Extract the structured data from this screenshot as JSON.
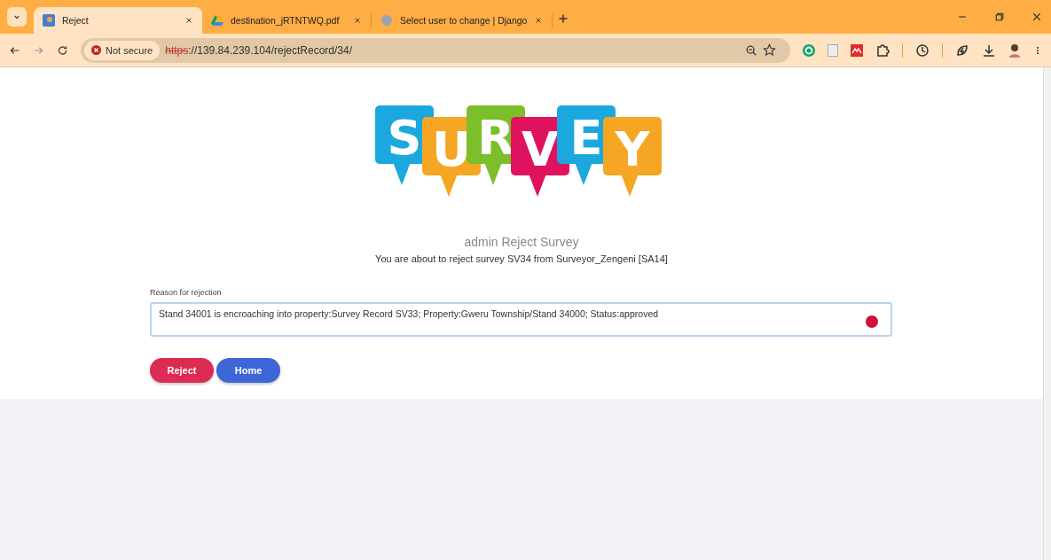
{
  "tabs": [
    {
      "title": "Reject",
      "selected": true,
      "kind": "site"
    },
    {
      "title": "destination_jRTNTWQ.pdf",
      "selected": false,
      "kind": "drive"
    },
    {
      "title": "Select user to change | Django",
      "selected": false,
      "kind": "globe"
    }
  ],
  "address": {
    "security": "Not secure",
    "scheme": "https",
    "rest": "://139.84.239.104/rejectRecord/34/"
  },
  "logo": {
    "letters": [
      {
        "char": "S",
        "color": "#1ba8de"
      },
      {
        "char": "U",
        "color": "#f5a623"
      },
      {
        "char": "R",
        "color": "#7cbf2a"
      },
      {
        "char": "V",
        "color": "#e0115f"
      },
      {
        "char": "E",
        "color": "#1ba8de"
      },
      {
        "char": "Y",
        "color": "#f5a623"
      }
    ]
  },
  "heading": "admin Reject Survey",
  "subheading": "You are about to reject survey SV34 from Surveyor_Zengeni [SA14]",
  "reason": {
    "label": "Reason for rejection",
    "value": "Stand 34001 is encroaching into property:Survey Record SV33; Property:Gweru Township/Stand 34000; Status:approved"
  },
  "buttons": [
    {
      "label": "Reject",
      "kind": "danger"
    },
    {
      "label": "Home",
      "kind": "primary"
    }
  ]
}
